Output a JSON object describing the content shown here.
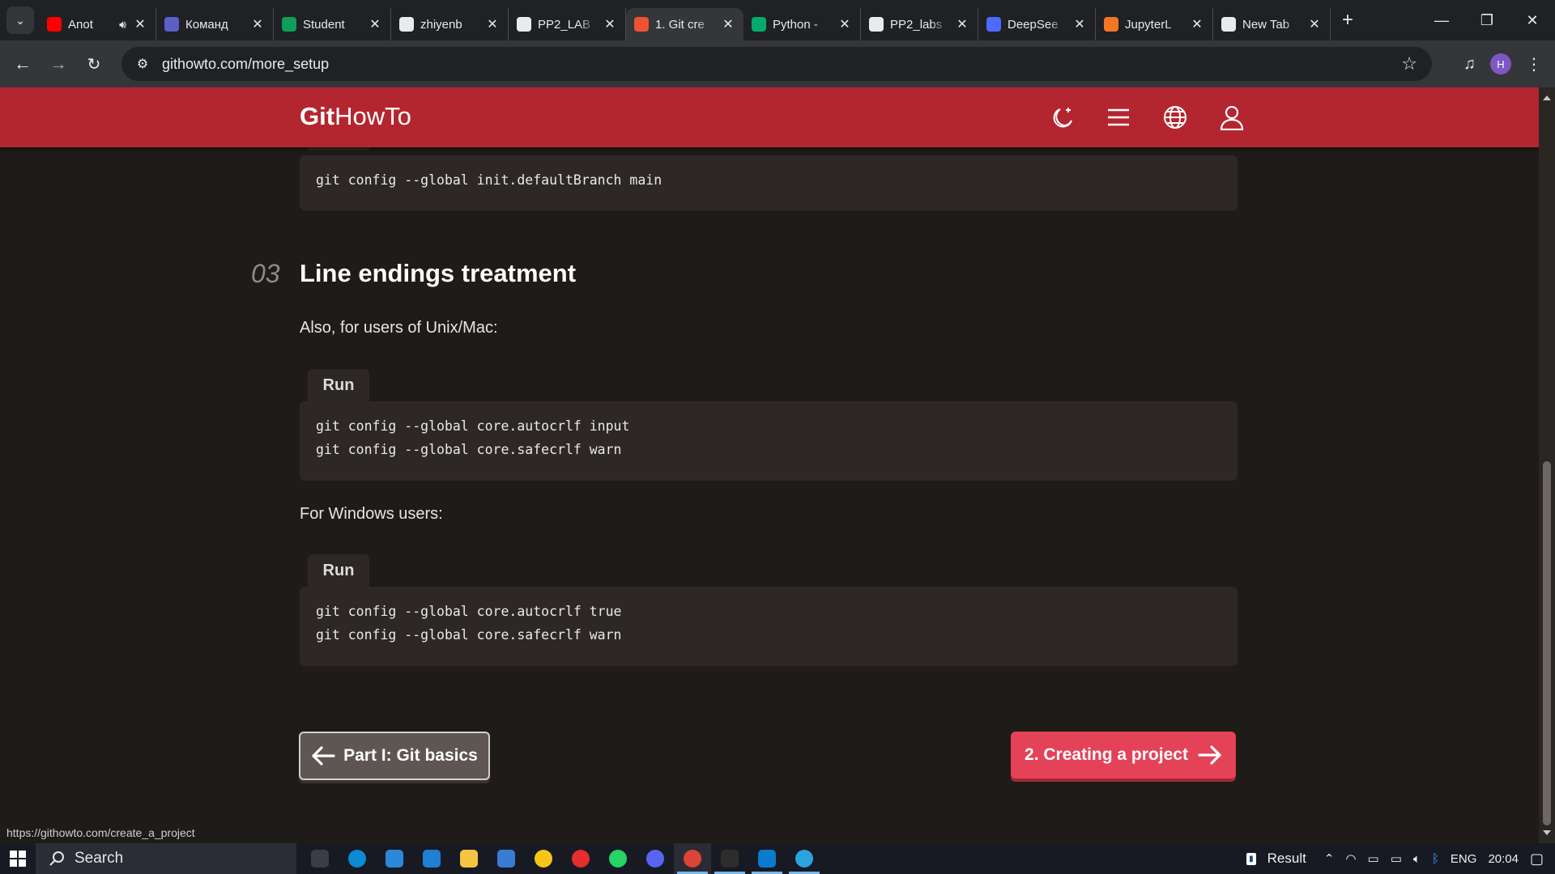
{
  "browser": {
    "tabs": [
      {
        "title": "Anot",
        "favicon": "youtube-icon",
        "color": "#ff0000",
        "audio": true,
        "active": false
      },
      {
        "title": "Команд",
        "favicon": "teams-icon",
        "color": "#5b5fc7",
        "audio": false,
        "active": false
      },
      {
        "title": "Student",
        "favicon": "sheets-icon",
        "color": "#0f9d58",
        "audio": false,
        "active": false
      },
      {
        "title": "zhiyenb",
        "favicon": "github-icon",
        "color": "#e8eaed",
        "audio": false,
        "active": false
      },
      {
        "title": "PP2_LAB",
        "favicon": "github-icon",
        "color": "#e8eaed",
        "audio": false,
        "active": false
      },
      {
        "title": "1. Git cre",
        "favicon": "githowto-icon",
        "color": "#f05133",
        "audio": false,
        "active": true
      },
      {
        "title": "Python -",
        "favicon": "w3schools-icon",
        "color": "#04aa6d",
        "audio": false,
        "active": false
      },
      {
        "title": "PP2_labs",
        "favicon": "github-icon",
        "color": "#e8eaed",
        "audio": false,
        "active": false
      },
      {
        "title": "DeepSee",
        "favicon": "deepseek-icon",
        "color": "#4d6bfe",
        "audio": false,
        "active": false
      },
      {
        "title": "JupyterL",
        "favicon": "jupyter-icon",
        "color": "#f37626",
        "audio": false,
        "active": false
      },
      {
        "title": "New Tab",
        "favicon": "chrome-icon",
        "color": "#e8eaed",
        "audio": false,
        "active": false
      }
    ],
    "url": "githowto.com/more_setup",
    "profile_initial": "H",
    "status_url": "https://githowto.com/create_a_project"
  },
  "site": {
    "logo_bold": "Git",
    "logo_regular": "HowTo",
    "brand_color": "#b4262f",
    "header_icons": [
      "theme-toggle-icon",
      "menu-icon",
      "language-globe-icon",
      "user-icon"
    ]
  },
  "content": {
    "prev_code": [
      "git config --global init.defaultBranch main"
    ],
    "section_number": "03",
    "section_title": "Line endings treatment",
    "unix_intro": "Also, for users of Unix/Mac:",
    "run_label": "Run",
    "unix_code": [
      "git config --global core.autocrlf input",
      "git config --global core.safecrlf warn"
    ],
    "windows_intro": "For Windows users:",
    "windows_code": [
      "git config --global core.autocrlf true",
      "git config --global core.safecrlf warn"
    ],
    "prev_button": "Part I: Git basics",
    "next_button": "2. Creating a project",
    "next_button_color": "#e44257"
  },
  "taskbar": {
    "search_placeholder": "Search",
    "apps": [
      "task-view-icon",
      "edge-icon",
      "store-icon",
      "mail-icon",
      "file-explorer-icon",
      "microsoft-store-icon",
      "norton-icon",
      "yandex-icon",
      "whatsapp-icon",
      "discord-icon",
      "chrome-icon",
      "terminal-icon",
      "vscode-icon",
      "telegram-icon"
    ],
    "tray_result": "Result",
    "language": "ENG",
    "time": "20:04"
  }
}
